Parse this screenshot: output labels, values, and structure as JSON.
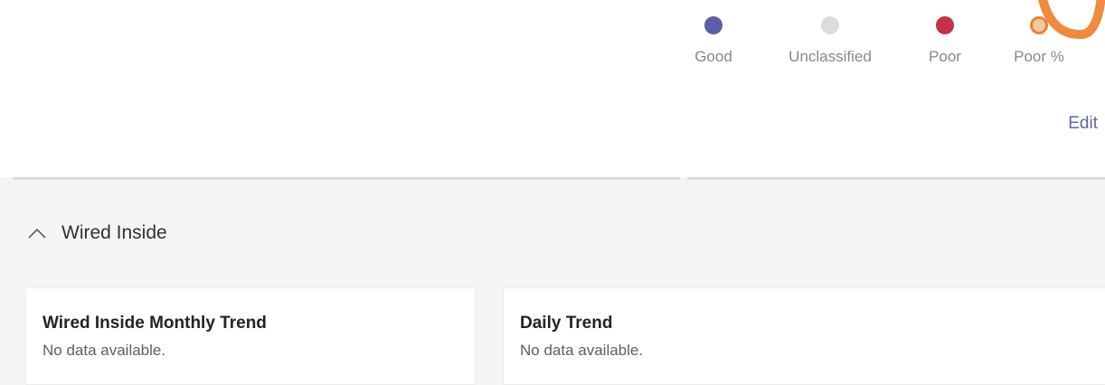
{
  "legend": {
    "items": [
      {
        "label": "Good",
        "color": "#5b5fa8",
        "icon": "circle-dot"
      },
      {
        "label": "Unclassified",
        "color": "#dcdcdc",
        "icon": "circle-dot"
      },
      {
        "label": "Poor",
        "color": "#c4314b",
        "icon": "circle-dot"
      },
      {
        "label": "Poor %",
        "color": "#e8813a",
        "icon": "ring-dot"
      }
    ]
  },
  "toolbar": {
    "edit_label": "Edit"
  },
  "section": {
    "title": "Wired Inside",
    "expanded": true,
    "icon": "chevron-up-icon"
  },
  "cards": {
    "monthly": {
      "title": "Wired Inside Monthly Trend",
      "status": "No data available."
    },
    "daily": {
      "title": "Daily Trend",
      "status": "No data available."
    }
  },
  "colors": {
    "accent": "#6264a7",
    "annotation": "#f08a3c"
  }
}
